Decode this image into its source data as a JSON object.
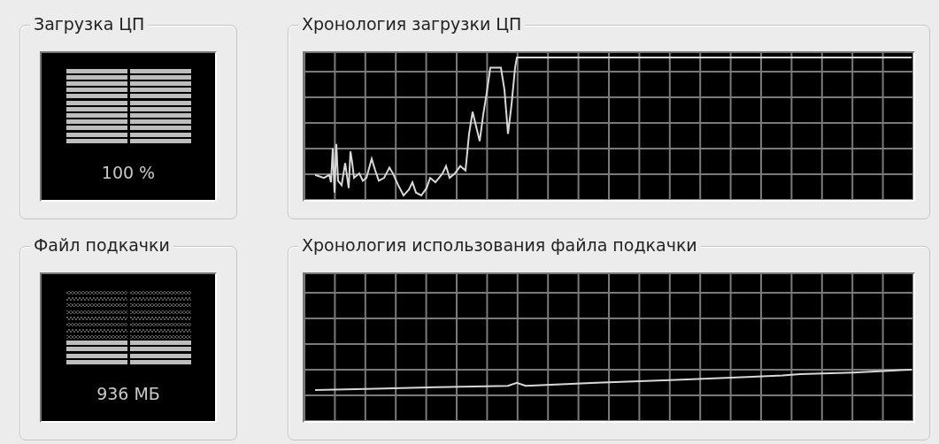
{
  "panels": [
    {
      "title": "Загрузка ЦП",
      "kind": "meter",
      "reading": "100 %"
    },
    {
      "title": "Хронология загрузки ЦП",
      "kind": "graph"
    },
    {
      "title": "Файл подкачки",
      "kind": "meter",
      "reading": "936 МБ"
    },
    {
      "title": "Хронология использования файла подкачки",
      "kind": "graph"
    }
  ]
}
